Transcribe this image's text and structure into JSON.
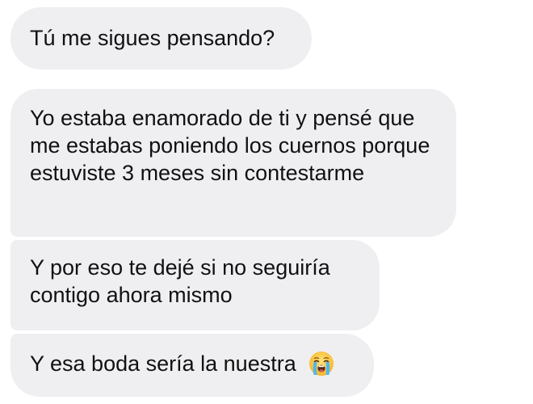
{
  "messages": [
    {
      "text": "Tú me sigues pensando?"
    },
    {
      "text": "Yo estaba enamorado de ti y pensé que me estabas poniendo los cuernos porque estuviste 3 meses sin contestarme"
    },
    {
      "text": "Y por eso te dejé si no seguiría contigo ahora mismo"
    },
    {
      "text": "Y esa boda sería la nuestra",
      "emoji": "loudly-crying-face-icon"
    }
  ],
  "colors": {
    "bubble": "#efeff2",
    "text": "#111111",
    "background": "#ffffff"
  }
}
